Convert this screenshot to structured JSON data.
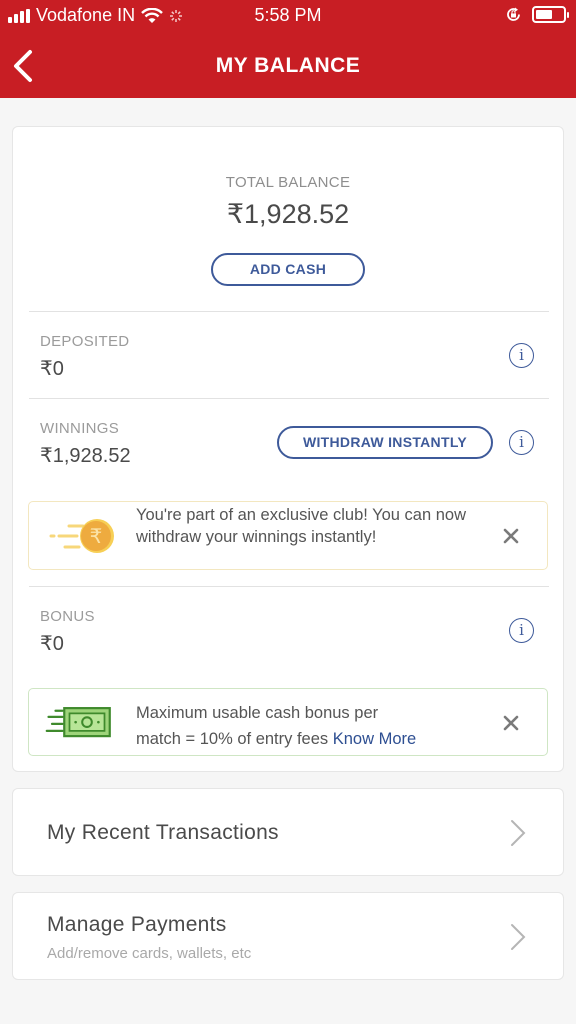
{
  "status_bar": {
    "carrier": "Vodafone IN",
    "time": "5:58 PM",
    "icons": [
      "signal-icon",
      "wifi-icon",
      "activity-spinner-icon",
      "rotation-lock-icon",
      "battery-icon"
    ]
  },
  "header": {
    "title": "MY BALANCE",
    "back_icon": "chevron-left-icon",
    "color": "#c81e24"
  },
  "balance": {
    "total_label": "TOTAL BALANCE",
    "total_value": "₹1,928.52",
    "add_cash_label": "ADD CASH"
  },
  "rows": {
    "deposited": {
      "label": "DEPOSITED",
      "value": "₹0",
      "icon": "info-icon"
    },
    "winnings": {
      "label": "WINNINGS",
      "value": "₹1,928.52",
      "button_label": "WITHDRAW INSTANTLY",
      "icon": "info-icon"
    },
    "bonus": {
      "label": "BONUS",
      "value": "₹0",
      "icon": "info-icon"
    }
  },
  "banners": {
    "exclusive": {
      "line1": "You're part of an exclusive club! You can now",
      "line2": "withdraw your winnings instantly!",
      "icon": "rupee-coin-icon",
      "close_icon": "close-icon"
    },
    "bonus_info": {
      "line1": "Maximum usable cash bonus per",
      "line2": "match = 10% of entry fees",
      "link": "Know More",
      "icon": "cash-note-icon",
      "close_icon": "close-icon"
    }
  },
  "nav": {
    "transactions": {
      "title": "My Recent Transactions",
      "icon": "chevron-right-icon"
    },
    "payments": {
      "title": "Manage Payments",
      "subtitle": "Add/remove cards, wallets, etc",
      "icon": "chevron-right-icon"
    }
  },
  "colors": {
    "brand_red": "#c81e24",
    "accent_blue": "#3e5a9a",
    "gold": "#f2b33d",
    "green": "#5aa43a"
  }
}
